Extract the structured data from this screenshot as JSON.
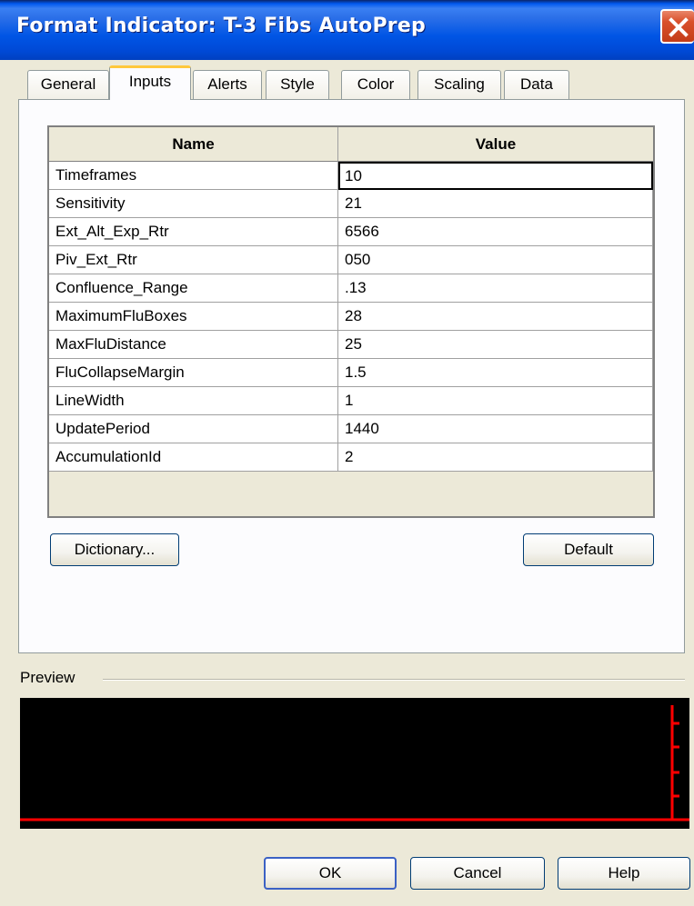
{
  "window": {
    "title": "Format Indicator: T-3 Fibs AutoPrep",
    "close_symbol": "✕"
  },
  "tabs": [
    {
      "label": "General",
      "active": false
    },
    {
      "label": "Inputs",
      "active": true
    },
    {
      "label": "Alerts",
      "active": false
    },
    {
      "label": "Style",
      "active": false
    },
    {
      "label": "Color",
      "active": false
    },
    {
      "label": "Scaling",
      "active": false
    },
    {
      "label": "Data",
      "active": false
    }
  ],
  "inputs_table": {
    "columns": [
      "Name",
      "Value"
    ],
    "rows": [
      {
        "name": "Timeframes",
        "value": "10"
      },
      {
        "name": "Sensitivity",
        "value": "21"
      },
      {
        "name": "Ext_Alt_Exp_Rtr",
        "value": "6566"
      },
      {
        "name": "Piv_Ext_Rtr",
        "value": "050"
      },
      {
        "name": "Confluence_Range",
        "value": ".13"
      },
      {
        "name": "MaximumFluBoxes",
        "value": "28"
      },
      {
        "name": "MaxFluDistance",
        "value": "25"
      },
      {
        "name": "FluCollapseMargin",
        "value": "1.5"
      },
      {
        "name": "LineWidth",
        "value": "1"
      },
      {
        "name": "UpdatePeriod",
        "value": "1440"
      },
      {
        "name": "AccumulationId",
        "value": "2"
      }
    ]
  },
  "buttons": {
    "dictionary": "Dictionary...",
    "default": "Default",
    "ok": "OK",
    "cancel": "Cancel",
    "help": "Help"
  },
  "preview": {
    "label": "Preview",
    "line_color": "#FF0000",
    "background": "#000000"
  },
  "colors": {
    "titlebar": "#0055E5",
    "dialog_bg": "#ECE9D8",
    "active_tab_highlight": "#FFC83C"
  }
}
